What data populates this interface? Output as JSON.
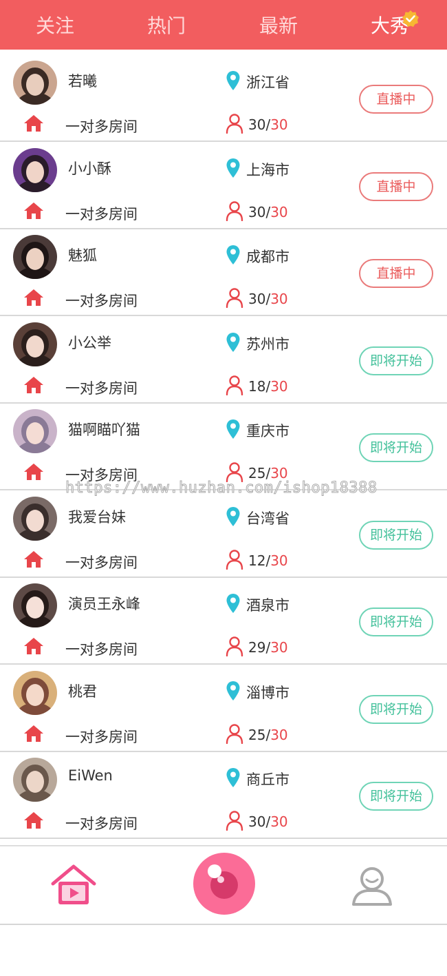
{
  "tabs": [
    "关注",
    "热门",
    "最新",
    "大秀"
  ],
  "active_tab_index": 3,
  "colors": {
    "header_bg": "#f25d5f",
    "live_status": "#ea5c5c",
    "upcoming_status": "#44c19b",
    "pin": "#2ebfd6",
    "count_max": "#e8454a",
    "nav_accent": "#f04e8a"
  },
  "icons": {
    "badge": "check-badge-icon",
    "location": "map-pin-icon",
    "room": "home-icon",
    "viewers": "person-icon",
    "nav_home": "home-play-icon",
    "nav_camera": "camera-lens-icon",
    "nav_user": "user-icon"
  },
  "rooms": [
    {
      "name": "若曦",
      "city": "浙江省",
      "room_type": "一对多房间",
      "count": "30",
      "max": "30",
      "status": "直播中",
      "status_type": "live"
    },
    {
      "name": "小小酥",
      "city": "上海市",
      "room_type": "一对多房间",
      "count": "30",
      "max": "30",
      "status": "直播中",
      "status_type": "live"
    },
    {
      "name": "魅狐",
      "city": "成都市",
      "room_type": "一对多房间",
      "count": "30",
      "max": "30",
      "status": "直播中",
      "status_type": "live"
    },
    {
      "name": "小公举",
      "city": "苏州市",
      "room_type": "一对多房间",
      "count": "18",
      "max": "30",
      "status": "即将开始",
      "status_type": "soon"
    },
    {
      "name": "猫啊瞄吖猫",
      "city": "重庆市",
      "room_type": "一对多房间",
      "count": "25",
      "max": "30",
      "status": "即将开始",
      "status_type": "soon"
    },
    {
      "name": "我爱台妹",
      "city": "台湾省",
      "room_type": "一对多房间",
      "count": "12",
      "max": "30",
      "status": "即将开始",
      "status_type": "soon"
    },
    {
      "name": "演员王永峰",
      "city": "酒泉市",
      "room_type": "一对多房间",
      "count": "29",
      "max": "30",
      "status": "即将开始",
      "status_type": "soon"
    },
    {
      "name": "桃君",
      "city": "淄博市",
      "room_type": "一对多房间",
      "count": "25",
      "max": "30",
      "status": "即将开始",
      "status_type": "soon"
    },
    {
      "name": "EiWen",
      "city": "商丘市",
      "room_type": "一对多房间",
      "count": "30",
      "max": "30",
      "status": "即将开始",
      "status_type": "soon"
    }
  ],
  "watermark": "https://www.huzhan.com/ishop18388"
}
